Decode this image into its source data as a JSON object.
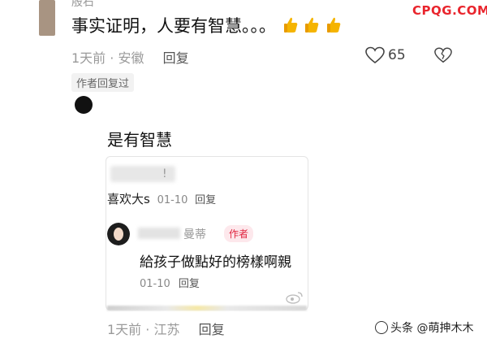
{
  "site_logo": "CPQG.COM",
  "top_comment": {
    "username": "殷石",
    "text": "事实证明，人要有智慧。。。",
    "time": "1天前",
    "location": "安徽",
    "reply_label": "回复",
    "likes": "65",
    "author_replied": "作者回复过"
  },
  "reply": {
    "text": "是有智慧",
    "card": {
      "comment_text": "喜欢大s",
      "comment_date": "01-10",
      "comment_reply": "回复",
      "blur_mark": "!",
      "sub": {
        "name": "曼蒂",
        "author_badge": "作者",
        "text": "給孩子做點好的榜樣啊親",
        "date": "01-10",
        "reply_label": "回复"
      }
    },
    "time": "1天前",
    "location": "江苏",
    "reply_label": "回复"
  },
  "watermark": "头条 @萌抻木木",
  "colors": {
    "logo": "#e9252d",
    "badge": "#e0243f",
    "thumb": "#f5b400"
  }
}
